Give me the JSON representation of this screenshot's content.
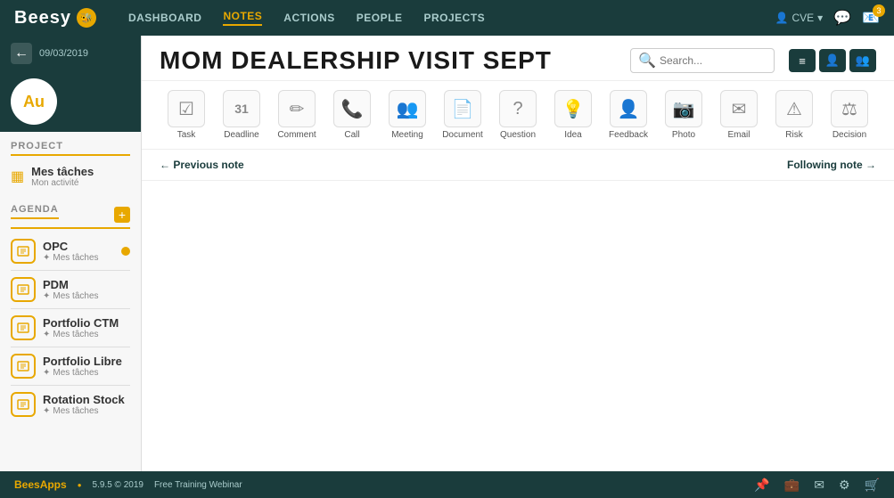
{
  "app": {
    "name": "Beesy",
    "version": "5.9.5 © 2019",
    "webinar": "Free Training Webinar"
  },
  "nav": {
    "links": [
      "DASHBOARD",
      "NOTES",
      "ACTIONS",
      "PEOPLE",
      "PROJECTS"
    ],
    "active": "NOTES",
    "user": "CVE"
  },
  "search": {
    "placeholder": "Search..."
  },
  "note": {
    "date": "09/03/2019",
    "title": "MOM DEALERSHIP VISIT SEPT",
    "avatar_initials": "Au"
  },
  "tools": [
    {
      "id": "task",
      "icon": "☑",
      "label": "Task"
    },
    {
      "id": "deadline",
      "icon": "31",
      "label": "Deadline"
    },
    {
      "id": "comment",
      "icon": "✏",
      "label": "Comment"
    },
    {
      "id": "call",
      "icon": "📞",
      "label": "Call"
    },
    {
      "id": "meeting",
      "icon": "👥",
      "label": "Meeting"
    },
    {
      "id": "document",
      "icon": "📄",
      "label": "Document"
    },
    {
      "id": "question",
      "icon": "?",
      "label": "Question"
    },
    {
      "id": "idea",
      "icon": "💡",
      "label": "Idea"
    },
    {
      "id": "feedback",
      "icon": "👤",
      "label": "Feedback"
    },
    {
      "id": "photo",
      "icon": "📷",
      "label": "Photo"
    },
    {
      "id": "email",
      "icon": "✉",
      "label": "Email"
    },
    {
      "id": "risk",
      "icon": "⚠",
      "label": "Risk"
    },
    {
      "id": "decision",
      "icon": "⚖",
      "label": "Decision"
    }
  ],
  "note_nav": {
    "prev": "← Previous note",
    "next": "Following note →"
  },
  "project_section": {
    "title": "PROJECT",
    "name": "Mes tâches",
    "sub": "Mon activité"
  },
  "agenda_section": {
    "title": "AGENDA",
    "items": [
      {
        "name": "OPC",
        "sub": "Mes tâches",
        "dot": true
      },
      {
        "name": "PDM",
        "sub": "Mes tâches",
        "dot": false
      },
      {
        "name": "Portfolio CTM",
        "sub": "Mes tâches",
        "dot": false
      },
      {
        "name": "Portfolio Libre",
        "sub": "Mes tâches",
        "dot": false
      },
      {
        "name": "Rotation Stock",
        "sub": "Mes tâches",
        "dot": false
      }
    ]
  },
  "bottom": {
    "logo": "BeesApps",
    "dot": "●",
    "version": "5.9.5 © 2019",
    "webinar": "Free Training Webinar"
  }
}
